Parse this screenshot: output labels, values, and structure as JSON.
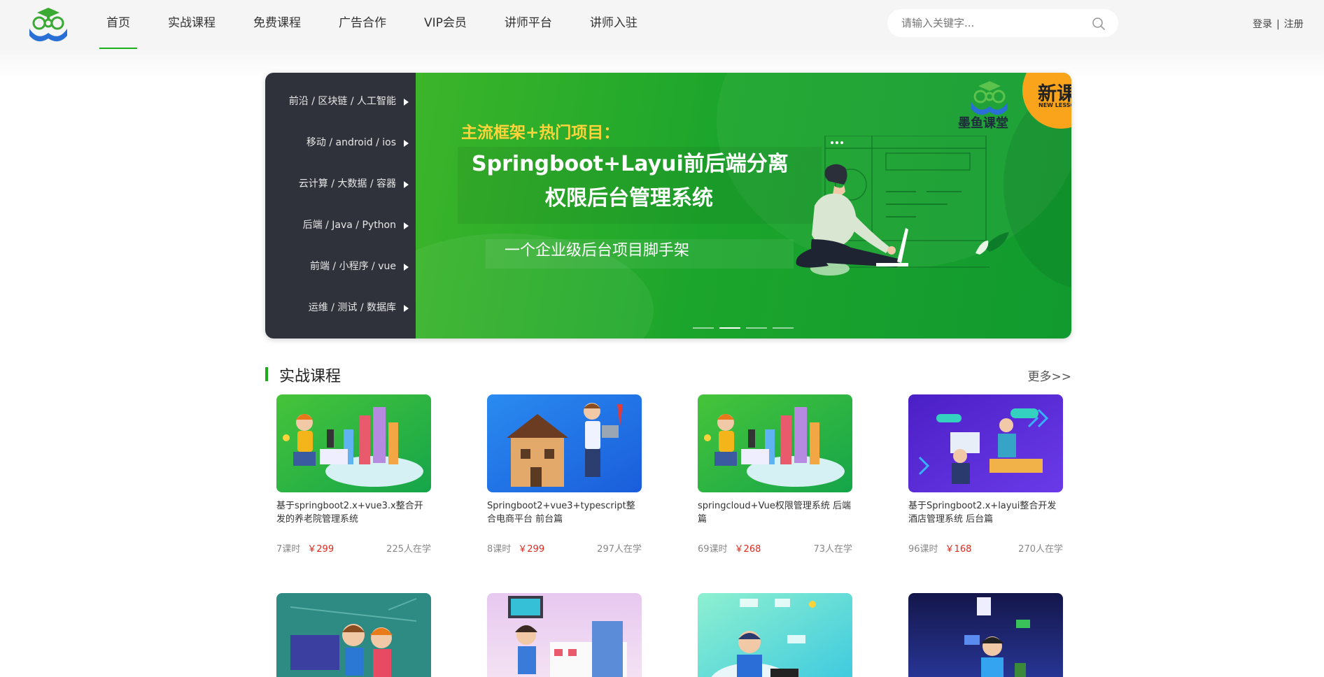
{
  "header": {
    "nav": [
      "首页",
      "实战课程",
      "免费课程",
      "广告合作",
      "VIP会员",
      "讲师平台",
      "讲师入驻"
    ],
    "search_placeholder": "请输入关键字...",
    "login": "登录",
    "separator": "|",
    "register": "注册"
  },
  "banner": {
    "categories": [
      "前沿 / 区块链 / 人工智能",
      "移动 / android / ios",
      "云计算 / 大数据 / 容器",
      "后端 / Java / Python",
      "前端 / 小程序 / vue",
      "运维 / 测试 / 数据库"
    ],
    "tag": "主流框架+热门项目：",
    "title_line1": "Springboot+Layui前后端分离",
    "title_line2": "权限后台管理系统",
    "subtitle": "一个企业级后台项目脚手架",
    "brand": "墨鱼课堂",
    "badge": "新课",
    "badge_sub": "NEW LESSON",
    "active_slide": 2,
    "slide_count": 4
  },
  "section": {
    "title": "实战课程",
    "more": "更多>>"
  },
  "courses": [
    {
      "title": "基于springboot2.x+vue3.x整合开发的养老院管理系统",
      "lessons": "7课时",
      "price": "￥299",
      "students": "225人在学",
      "thumb": "developer-city"
    },
    {
      "title": "Springboot2+vue3+typescript整合电商平台 前台篇",
      "lessons": "8课时",
      "price": "￥299",
      "students": "297人在学",
      "thumb": "house-builder"
    },
    {
      "title": "springcloud+Vue权限管理系统 后端篇",
      "lessons": "69课时",
      "price": "￥268",
      "students": "73人在学",
      "thumb": "developer-city"
    },
    {
      "title": "基于Springboot2.x+layui整合开发酒店管理系统 后台篇",
      "lessons": "96课时",
      "price": "￥168",
      "students": "270人在学",
      "thumb": "online-meeting"
    },
    {
      "title": "",
      "lessons": "",
      "price": "",
      "students": "",
      "thumb": "kids-classroom"
    },
    {
      "title": "",
      "lessons": "",
      "price": "",
      "students": "",
      "thumb": "girl-laptop-city"
    },
    {
      "title": "",
      "lessons": "",
      "price": "",
      "students": "",
      "thumb": "engineer-code"
    },
    {
      "title": "",
      "lessons": "",
      "price": "",
      "students": "",
      "thumb": "web-developer"
    }
  ],
  "colors": {
    "accent": "#1aad19",
    "price": "#e0281f",
    "menu_bg": "#2f323a",
    "header_bg": "#f4f5f4"
  }
}
